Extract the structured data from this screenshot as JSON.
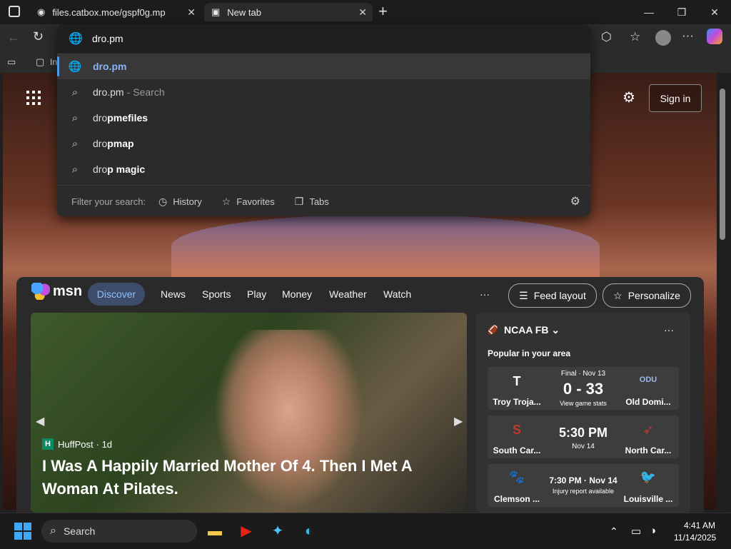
{
  "tabs": [
    {
      "label": "files.catbox.moe/gspf0g.mp",
      "close": "✕"
    },
    {
      "label": "New tab",
      "close": "✕"
    }
  ],
  "new_tab_symbol": "+",
  "window": {
    "minimize": "—",
    "maximize": "❐",
    "close": "✕"
  },
  "address": {
    "value": "dro.pm"
  },
  "suggestions": [
    {
      "prefix": "",
      "bold": "dro.pm",
      "suffix": "",
      "icon": "globe-icon"
    },
    {
      "prefix": "dro.pm",
      "bold": "",
      "suffix": "Search",
      "icon": "search-icon"
    },
    {
      "prefix": "dro",
      "bold": "pmefiles",
      "suffix": "",
      "icon": "search-icon"
    },
    {
      "prefix": "dro",
      "bold": "pmap",
      "suffix": "",
      "icon": "search-icon"
    },
    {
      "prefix": "dro",
      "bold": "p magic",
      "suffix": "",
      "icon": "search-icon"
    }
  ],
  "filter": {
    "label": "Filter your search:",
    "history": "History",
    "favorites": "Favorites",
    "tabs": "Tabs"
  },
  "favbar_fragment": "In",
  "page": {
    "signin": "Sign in"
  },
  "msn": {
    "logo": "msn",
    "nav": [
      "Discover",
      "News",
      "Sports",
      "Play",
      "Money",
      "Weather",
      "Watch"
    ],
    "more": "···",
    "feed_layout": "Feed layout",
    "personalize": "Personalize"
  },
  "news": {
    "source": "HuffPost",
    "source_logo": "H",
    "age": "· 1d",
    "headline": "I Was A Happily Married Mother Of 4. Then I Met A Woman At Pilates."
  },
  "sports": {
    "league": "NCAA FB",
    "subtitle": "Popular in your area",
    "more": "···",
    "games": [
      {
        "home": "Troy Troja...",
        "away": "Old Domi...",
        "status": "Final · Nov 13",
        "score": "0 - 33",
        "note": "View game stats",
        "home_logo": "T",
        "away_logo": "ODU"
      },
      {
        "home": "South Car...",
        "away": "North Car...",
        "status": "",
        "score": "5:30 PM",
        "note": "Nov 14",
        "home_logo": "S",
        "away_logo": "➶"
      },
      {
        "home": "Clemson ...",
        "away": "Louisville ...",
        "status": "",
        "score": "7:30 PM · Nov 14",
        "note": "Injury report available",
        "home_logo": "🐾",
        "away_logo": "🐦"
      }
    ]
  },
  "taskbar": {
    "search": "Search",
    "time": "4:41 AM",
    "date": "11/14/2025"
  }
}
